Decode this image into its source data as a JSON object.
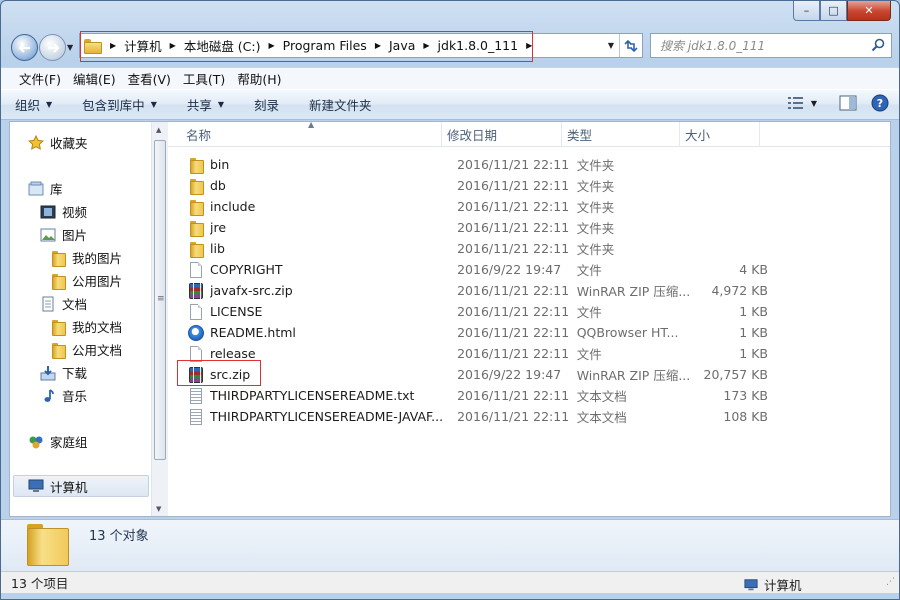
{
  "window": {
    "controls": {
      "minimize": "–",
      "maximize": "□",
      "close": "✕"
    }
  },
  "nav": {
    "back_icon": "back-arrow-icon",
    "forward_icon": "forward-arrow-icon"
  },
  "address": {
    "crumbs": [
      "计算机",
      "本地磁盘 (C:)",
      "Program Files",
      "Java",
      "jdk1.8.0_111"
    ],
    "refresh_icon": "refresh-icon"
  },
  "search": {
    "placeholder": "搜索 jdk1.8.0_111"
  },
  "menubar": {
    "items": [
      "文件(F)",
      "编辑(E)",
      "查看(V)",
      "工具(T)",
      "帮助(H)"
    ]
  },
  "toolbar": {
    "organize": "组织",
    "include_in_library": "包含到库中",
    "share": "共享",
    "burn": "刻录",
    "new_folder": "新建文件夹"
  },
  "sidebar": {
    "favorites": "收藏夹",
    "libraries": "库",
    "videos": "视频",
    "pictures": "图片",
    "my_pictures": "我的图片",
    "public_pictures": "公用图片",
    "documents": "文档",
    "my_documents": "我的文档",
    "public_documents": "公用文档",
    "downloads": "下载",
    "music": "音乐",
    "homegroup": "家庭组",
    "computer": "计算机"
  },
  "columns": {
    "name": "名称",
    "date": "修改日期",
    "type": "类型",
    "size": "大小"
  },
  "files": [
    {
      "name": "bin",
      "date": "2016/11/21 22:11",
      "type": "文件夹",
      "size": "",
      "icon": "folder"
    },
    {
      "name": "db",
      "date": "2016/11/21 22:11",
      "type": "文件夹",
      "size": "",
      "icon": "folder"
    },
    {
      "name": "include",
      "date": "2016/11/21 22:11",
      "type": "文件夹",
      "size": "",
      "icon": "folder"
    },
    {
      "name": "jre",
      "date": "2016/11/21 22:11",
      "type": "文件夹",
      "size": "",
      "icon": "folder"
    },
    {
      "name": "lib",
      "date": "2016/11/21 22:11",
      "type": "文件夹",
      "size": "",
      "icon": "folder"
    },
    {
      "name": "COPYRIGHT",
      "date": "2016/9/22 19:47",
      "type": "文件",
      "size": "4 KB",
      "icon": "file"
    },
    {
      "name": "javafx-src.zip",
      "date": "2016/11/21 22:11",
      "type": "WinRAR ZIP 压缩...",
      "size": "4,972 KB",
      "icon": "rar"
    },
    {
      "name": "LICENSE",
      "date": "2016/11/21 22:11",
      "type": "文件",
      "size": "1 KB",
      "icon": "file"
    },
    {
      "name": "README.html",
      "date": "2016/11/21 22:11",
      "type": "QQBrowser HT...",
      "size": "1 KB",
      "icon": "html"
    },
    {
      "name": "release",
      "date": "2016/11/21 22:11",
      "type": "文件",
      "size": "1 KB",
      "icon": "file"
    },
    {
      "name": "src.zip",
      "date": "2016/9/22 19:47",
      "type": "WinRAR ZIP 压缩...",
      "size": "20,757 KB",
      "icon": "rar"
    },
    {
      "name": "THIRDPARTYLICENSEREADME.txt",
      "date": "2016/11/21 22:11",
      "type": "文本文档",
      "size": "173 KB",
      "icon": "txt"
    },
    {
      "name": "THIRDPARTYLICENSEREADME-JAVAF...",
      "date": "2016/11/21 22:11",
      "type": "文本文档",
      "size": "108 KB",
      "icon": "txt"
    }
  ],
  "details": {
    "summary": "13 个对象"
  },
  "status": {
    "count": "13 个项目",
    "location": "计算机"
  }
}
